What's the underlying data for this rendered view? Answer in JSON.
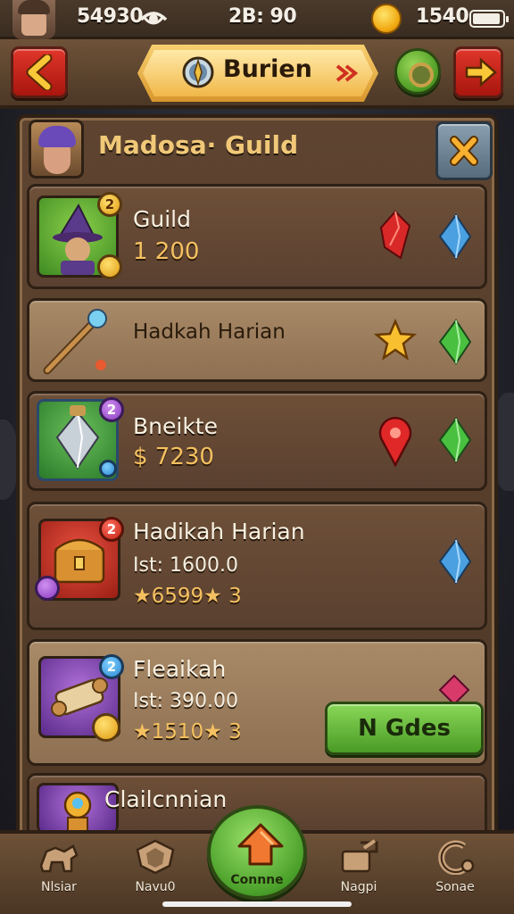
{
  "status_bar": {
    "left_value": "54930",
    "center_value": "2B: 90",
    "right_value": "1540"
  },
  "top_nav": {
    "title": "Burien"
  },
  "panel": {
    "title": "Madosa· Guild"
  },
  "items": [
    {
      "title": "Guild",
      "sub": "1 200",
      "badge": "2"
    },
    {
      "title": "Hadkah Harian"
    },
    {
      "title": "Bneikte",
      "sub": "$ 7230",
      "badge": "2"
    },
    {
      "title": "Hadikah Harian",
      "sub": "Ist: 1600.0",
      "stars": "6599",
      "stars_level": "3",
      "badge": "2"
    },
    {
      "title": "Fleaikah",
      "sub": "Ist: 390.00",
      "stars": "1510",
      "stars_level": "3",
      "badge": "2",
      "cta": "N Gdes"
    },
    {
      "title": "Clailcnnian"
    }
  ],
  "bottom_nav": {
    "items": [
      {
        "label": "Nlsiar",
        "icon": "beast-icon"
      },
      {
        "label": "Navu0",
        "icon": "shield-icon"
      },
      {
        "label": "Connne",
        "icon": "home-arrow-icon"
      },
      {
        "label": "Nagpi",
        "icon": "crafting-icon"
      },
      {
        "label": "Sonae",
        "icon": "settings-icon"
      }
    ]
  },
  "colors": {
    "panel_brown": "#5e4430",
    "gold_text": "#f0c878",
    "cta_green": "#4a9a26",
    "back_red": "#c0281c"
  }
}
